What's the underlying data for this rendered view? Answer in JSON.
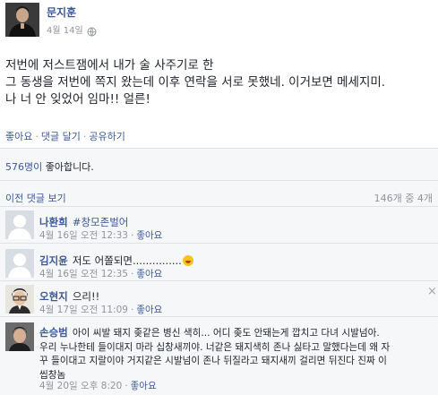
{
  "post": {
    "author": "문지훈",
    "date": "4월 14일",
    "lines": [
      "저번에 저스트잼에서 내가 술 사주기로 한",
      "그 동생을 저번에 쪽지 왔는데 이후 연락을 서로 못했네. 이거보면 메세지미.",
      "나 너 안 잊었어 임마!! 얼른!"
    ],
    "actions": [
      "좋아요",
      "댓글 달기",
      "공유하기"
    ]
  },
  "likes": {
    "count": "576명이",
    "suffix": " 좋아합니다."
  },
  "comments_header": {
    "previous": "이전 댓글 보기",
    "count": "146개 중 4개"
  },
  "comments": [
    {
      "name": "나환희",
      "text": "#창모존벌어",
      "time": "4월 16일 오전 12:33",
      "like": "좋아요"
    },
    {
      "name": "김지윤",
      "text": "저도 어쫄되면...............",
      "time": "4월 16일 오전 12:35",
      "like": "좋아요"
    },
    {
      "name": "오현지",
      "text": "으리!!",
      "time": "4월 17일 오전 11:09",
      "like": "좋아요",
      "close": "×"
    },
    {
      "name": "손승범",
      "lines": [
        "아이 씨발 돼지 좆같은 병신 색히... 어디 좆도 안돼는게 깝치고 다녀 시발넘아.",
        "우리 누나한테 들이대지 마라 십창새끼야. 너같은 돼지색히 존나 싫타고 말했다는데 왜 자",
        "꾸 들이대고 지랄이야 거지같은 시발넘이 존나 뒤질라고 돼지새끼 걸리면 뒤진다 진짜 이",
        "씹창놈"
      ],
      "time": "4월 20일 오후 8:20",
      "like": "좋아요"
    }
  ]
}
